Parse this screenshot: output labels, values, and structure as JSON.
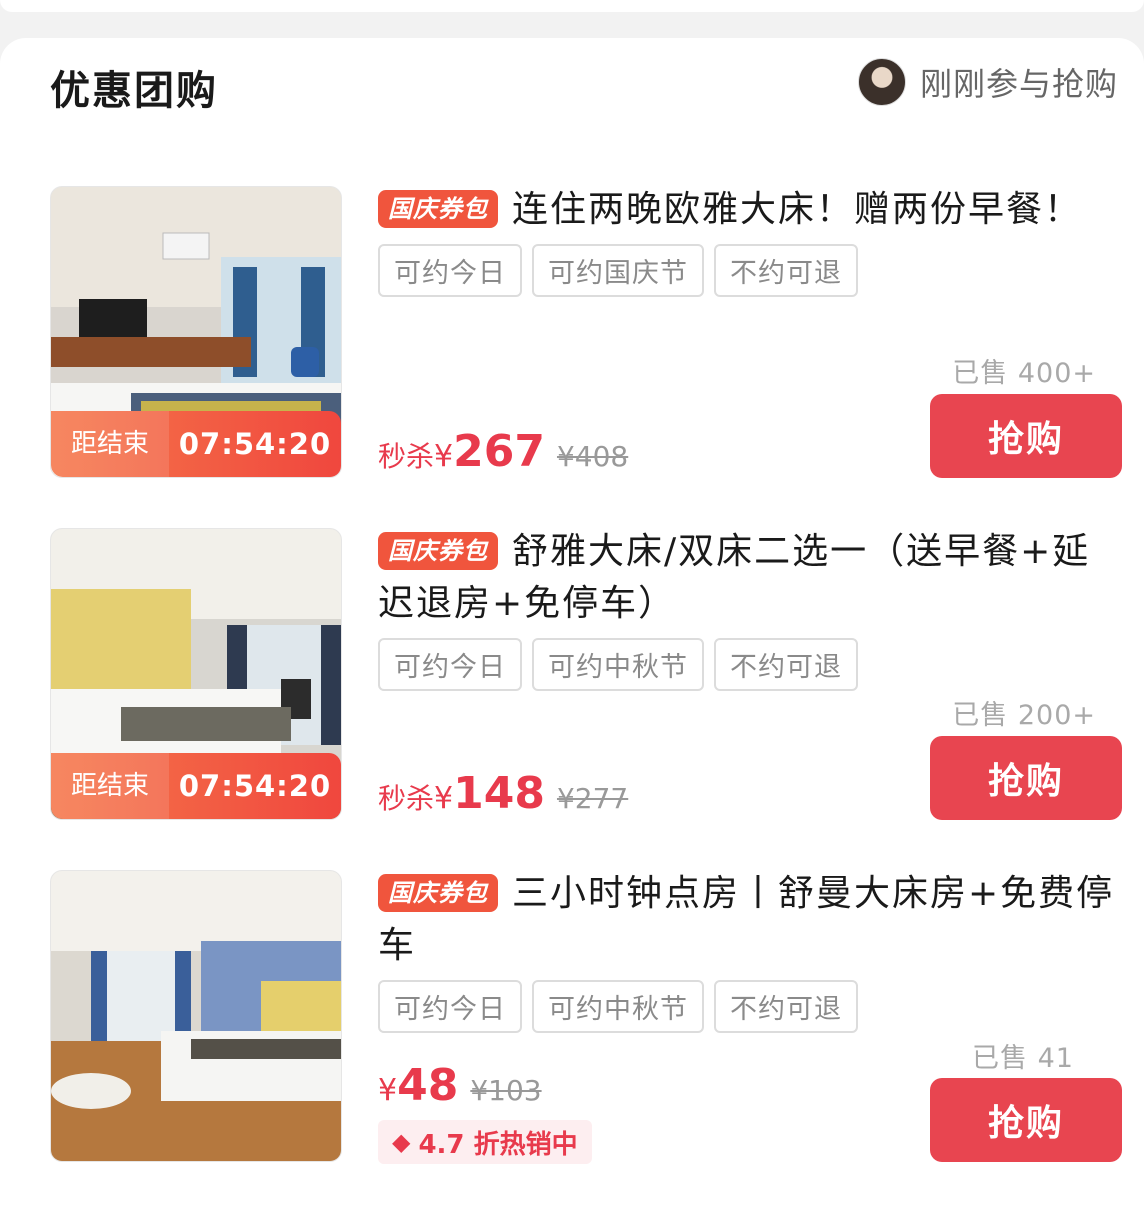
{
  "section": {
    "title": "优惠团购",
    "activity": "刚刚参与抢购"
  },
  "deals": [
    {
      "promo": "国庆券包",
      "title": "连住两晚欧雅大床！赠两份早餐！",
      "tags": [
        "可约今日",
        "可约国庆节",
        "不约可退"
      ],
      "sold": "已售 400+",
      "countdown_label": "距结束",
      "countdown_time": "07:54:20",
      "price_prefix": "秒杀",
      "currency": "¥",
      "price": "267",
      "original_price": "¥408",
      "buy_label": "抢购"
    },
    {
      "promo": "国庆券包",
      "title": "舒雅大床/双床二选一（送早餐+延迟退房+免停车）",
      "tags": [
        "可约今日",
        "可约中秋节",
        "不约可退"
      ],
      "sold": "已售 200+",
      "countdown_label": "距结束",
      "countdown_time": "07:54:20",
      "price_prefix": "秒杀",
      "currency": "¥",
      "price": "148",
      "original_price": "¥277",
      "buy_label": "抢购"
    },
    {
      "promo": "国庆券包",
      "title": "三小时钟点房丨舒曼大床房+免费停车",
      "tags": [
        "可约今日",
        "可约中秋节",
        "不约可退"
      ],
      "sold": "已售 41",
      "currency": "¥",
      "price": "48",
      "original_price": "¥103",
      "discount": "4.7 折热销中",
      "buy_label": "抢购"
    }
  ],
  "colors": {
    "accent": "#e84550",
    "promo_tag": "#f0553d",
    "countdown": "#f0473e",
    "price": "#e83a4c"
  },
  "icons": {
    "discount": "tag-icon",
    "avatar": "user-avatar"
  }
}
